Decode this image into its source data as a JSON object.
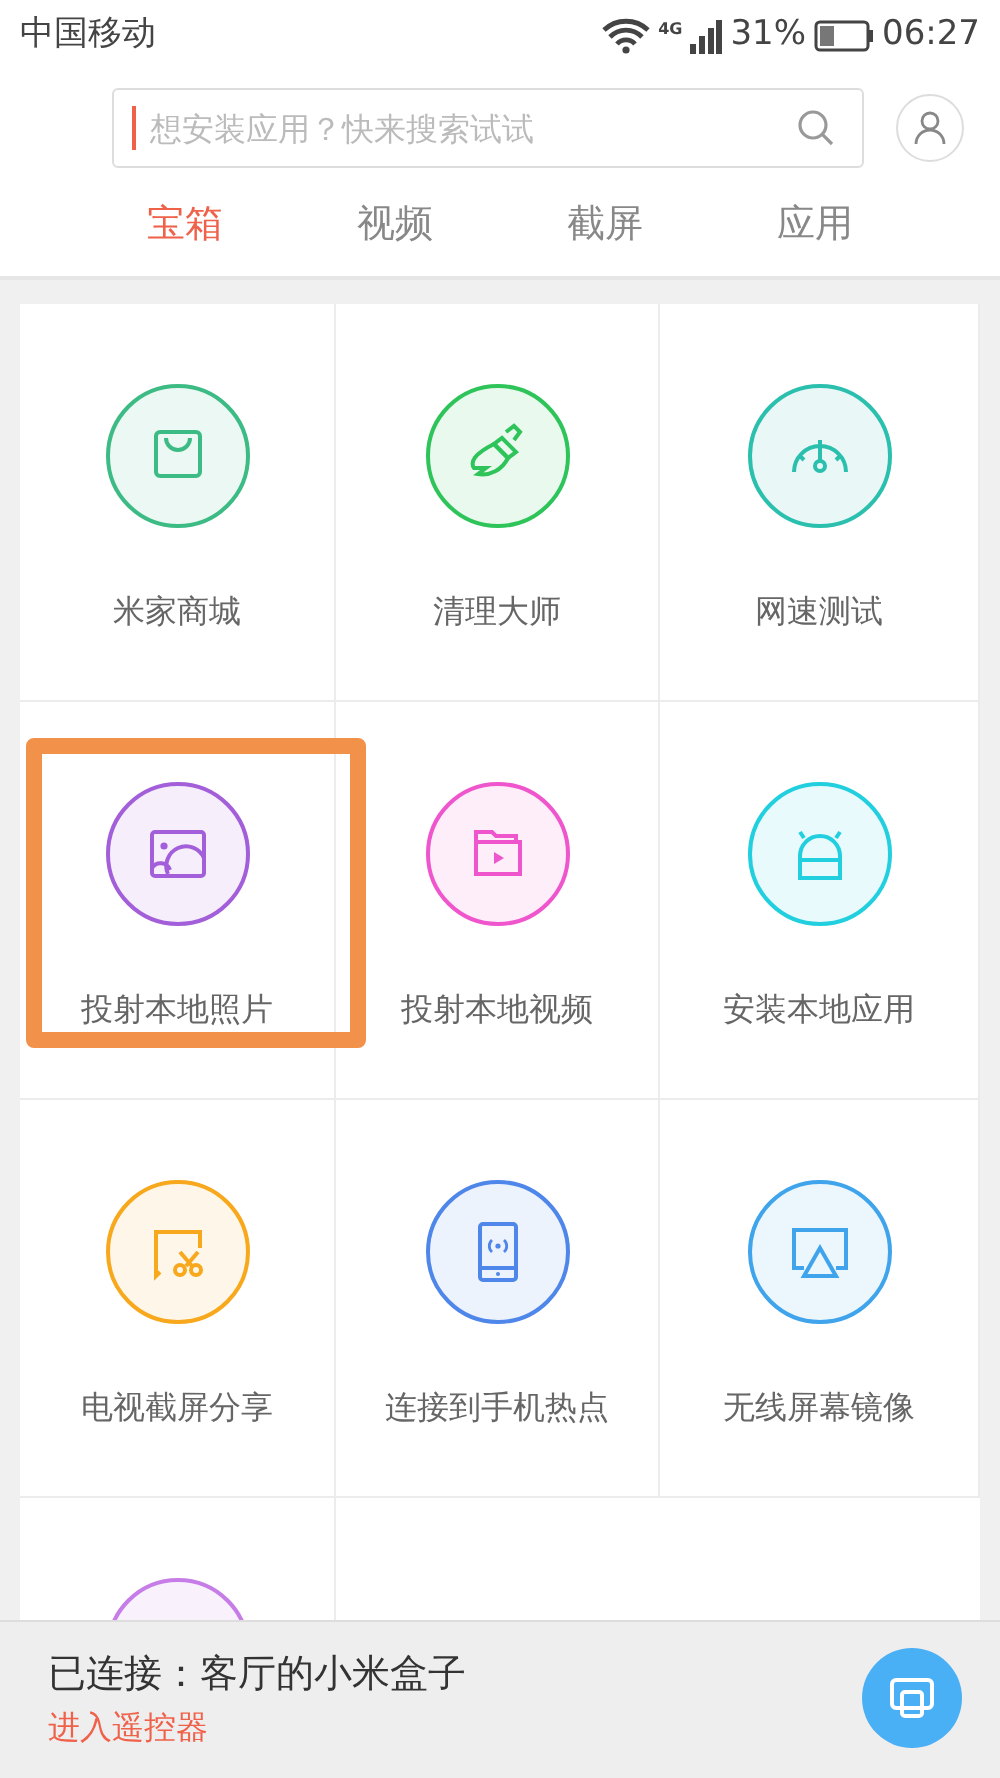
{
  "status_bar": {
    "carrier": "中国移动",
    "network": "4G",
    "battery": "31%",
    "time": "06:27"
  },
  "search": {
    "placeholder": "想安装应用？快来搜索试试"
  },
  "tabs": [
    {
      "label": "宝箱",
      "selected": true
    },
    {
      "label": "视频",
      "selected": false
    },
    {
      "label": "截屏",
      "selected": false
    },
    {
      "label": "应用",
      "selected": false
    }
  ],
  "tiles": [
    {
      "kind": "tile",
      "label": "米家商城",
      "color": "#3dbb85",
      "highlighted": false
    },
    {
      "kind": "tile",
      "label": "清理大师",
      "color": "#2ec45a",
      "highlighted": false
    },
    {
      "kind": "tile",
      "label": "网速测试",
      "color": "#2bbfae",
      "highlighted": false
    },
    {
      "kind": "tile",
      "label": "投射本地照片",
      "color": "#a35fd9",
      "highlighted": true
    },
    {
      "kind": "tile",
      "label": "投射本地视频",
      "color": "#ef55cc",
      "highlighted": false
    },
    {
      "kind": "tile",
      "label": "安装本地应用",
      "color": "#22cfdf",
      "highlighted": false
    },
    {
      "kind": "tile",
      "label": "电视截屏分享",
      "color": "#f7a81c",
      "highlighted": false
    },
    {
      "kind": "tile",
      "label": "连接到手机热点",
      "color": "#4f86ea",
      "highlighted": false
    },
    {
      "kind": "tile",
      "label": "无线屏幕镜像",
      "color": "#3fa4ec",
      "highlighted": false
    },
    {
      "kind": "partial",
      "color": "#c77de8",
      "highlighted": false
    }
  ],
  "connection": {
    "status": "已连接：客厅的小米盒子",
    "link": "进入遥控器"
  }
}
